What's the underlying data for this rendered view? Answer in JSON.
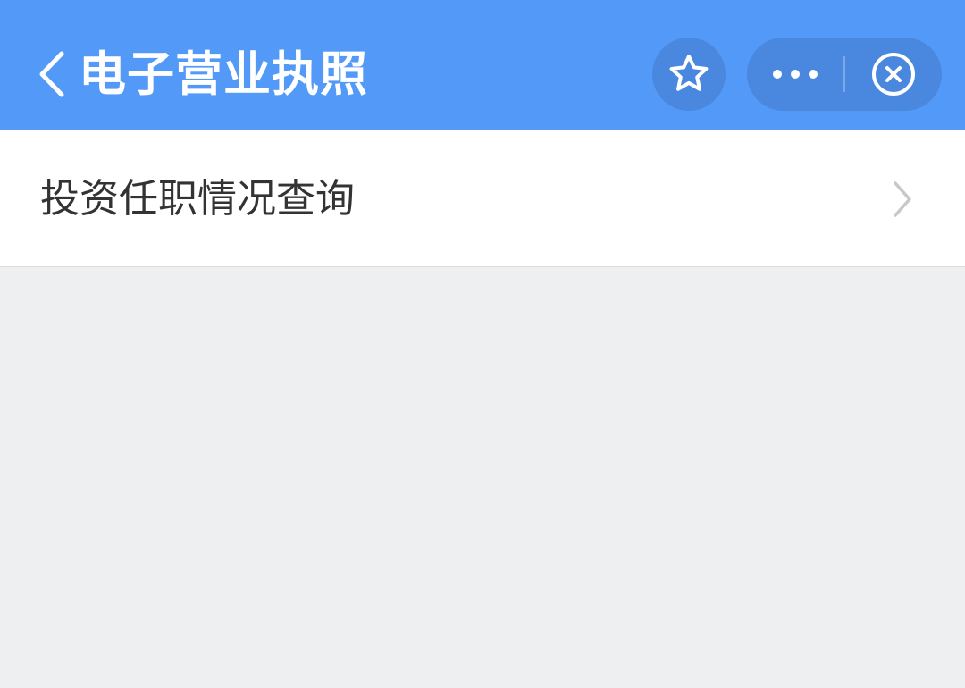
{
  "header": {
    "title": "电子营业执照",
    "background_color": "#5399f7",
    "button_background_color": "#4a87de",
    "icons": {
      "back": "back-chevron-icon",
      "favorite": "star-icon",
      "more": "more-dots-icon",
      "close": "close-circle-icon"
    }
  },
  "content": {
    "items": [
      {
        "label": "投资任职情况查询",
        "icon": "chevron-right-icon"
      }
    ],
    "background_color": "#eeeff1"
  }
}
